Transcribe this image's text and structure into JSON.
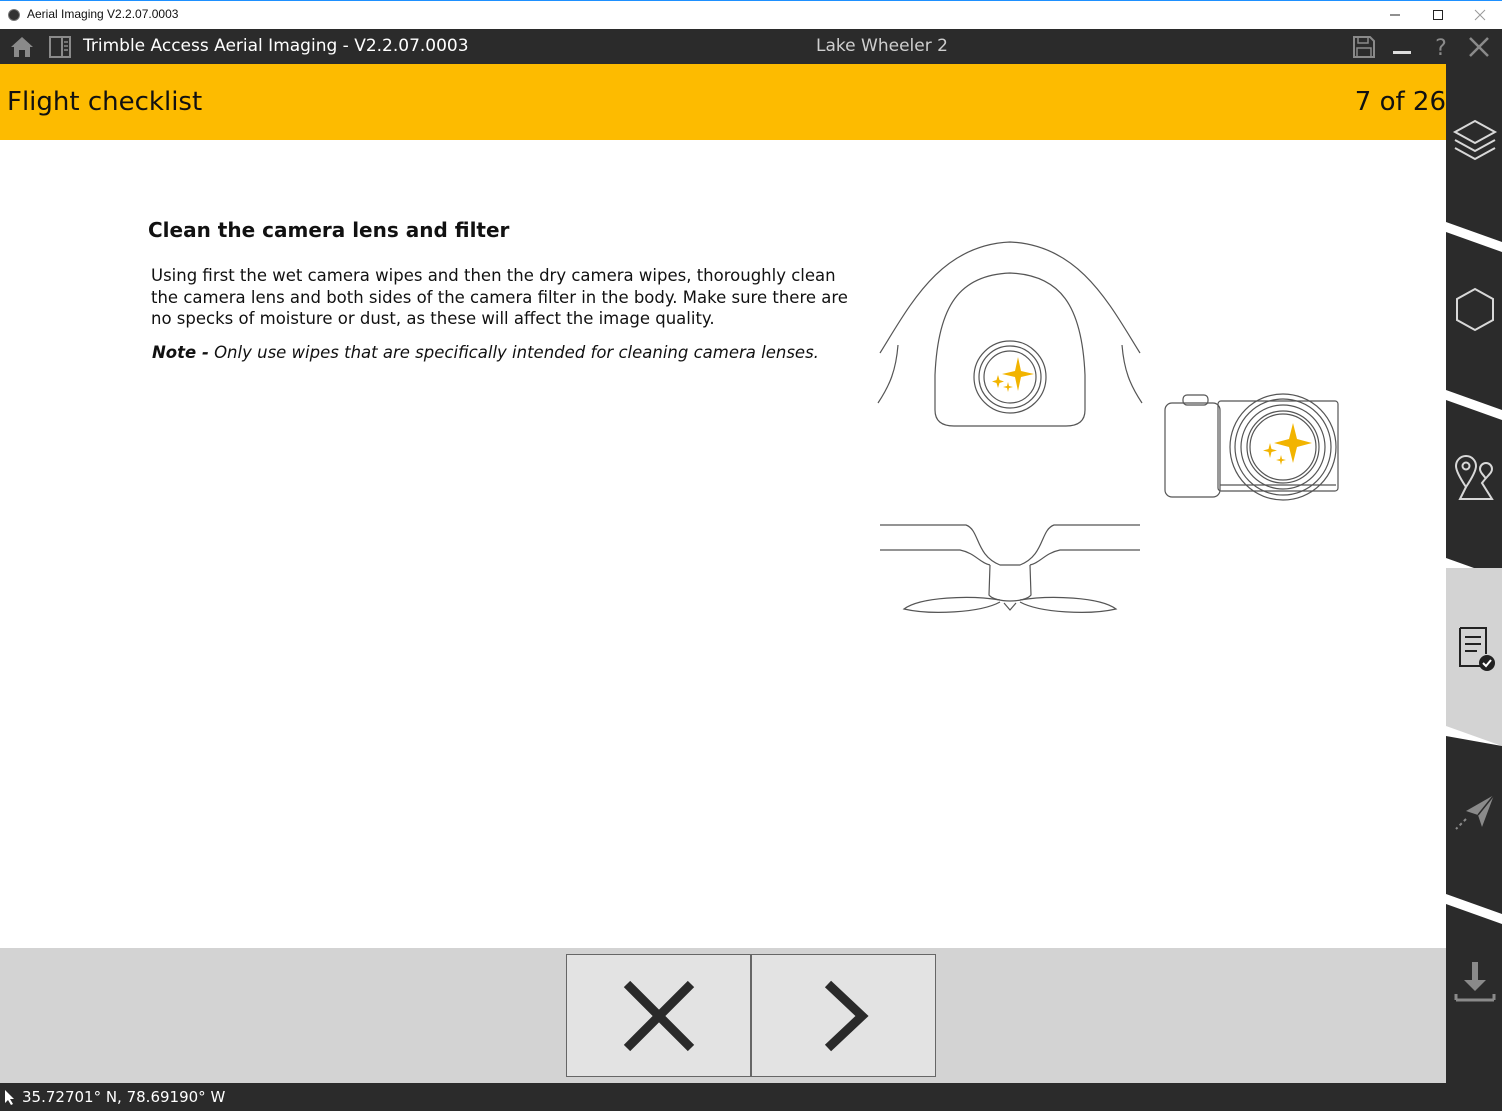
{
  "window": {
    "title": "Aerial Imaging V2.2.07.0003",
    "buttons": [
      "minimize-icon",
      "maximize-icon",
      "close-icon"
    ]
  },
  "appbar": {
    "title": "Trimble Access Aerial Imaging - V2.2.07.0003",
    "project": "Lake Wheeler 2",
    "icons": [
      "home-icon",
      "panel-icon",
      "save-icon",
      "minimize-icon",
      "help-icon",
      "close-icon"
    ]
  },
  "header": {
    "title": "Flight checklist",
    "counter": "7 of 26"
  },
  "step": {
    "title": "Clean the camera lens and filter",
    "body": "Using first the wet camera wipes and then the dry camera wipes, thoroughly clean the camera lens and both sides of the camera filter in the body. Make sure there are no specks of moisture or dust, as these will affect the image quality.",
    "note_label": "Note -",
    "note_text": " Only use wipes that are specifically intended for cleaning camera lenses."
  },
  "sidebar": {
    "tabs": [
      {
        "icon": "layers-icon",
        "active": false
      },
      {
        "icon": "hexagon-icon",
        "active": false
      },
      {
        "icon": "location-route-icon",
        "active": false
      },
      {
        "icon": "checklist-icon",
        "active": true
      },
      {
        "icon": "send-plane-icon",
        "active": false
      },
      {
        "icon": "download-icon",
        "active": false
      }
    ]
  },
  "footer": {
    "buttons": [
      "cancel-icon",
      "next-icon"
    ]
  },
  "status": {
    "coordinates": "35.72701° N, 78.69190° W"
  },
  "colors": {
    "accent": "#fdbb00",
    "appbar": "#2b2b2b",
    "footer": "#d3d3d3",
    "sparkle": "#f2b400"
  }
}
